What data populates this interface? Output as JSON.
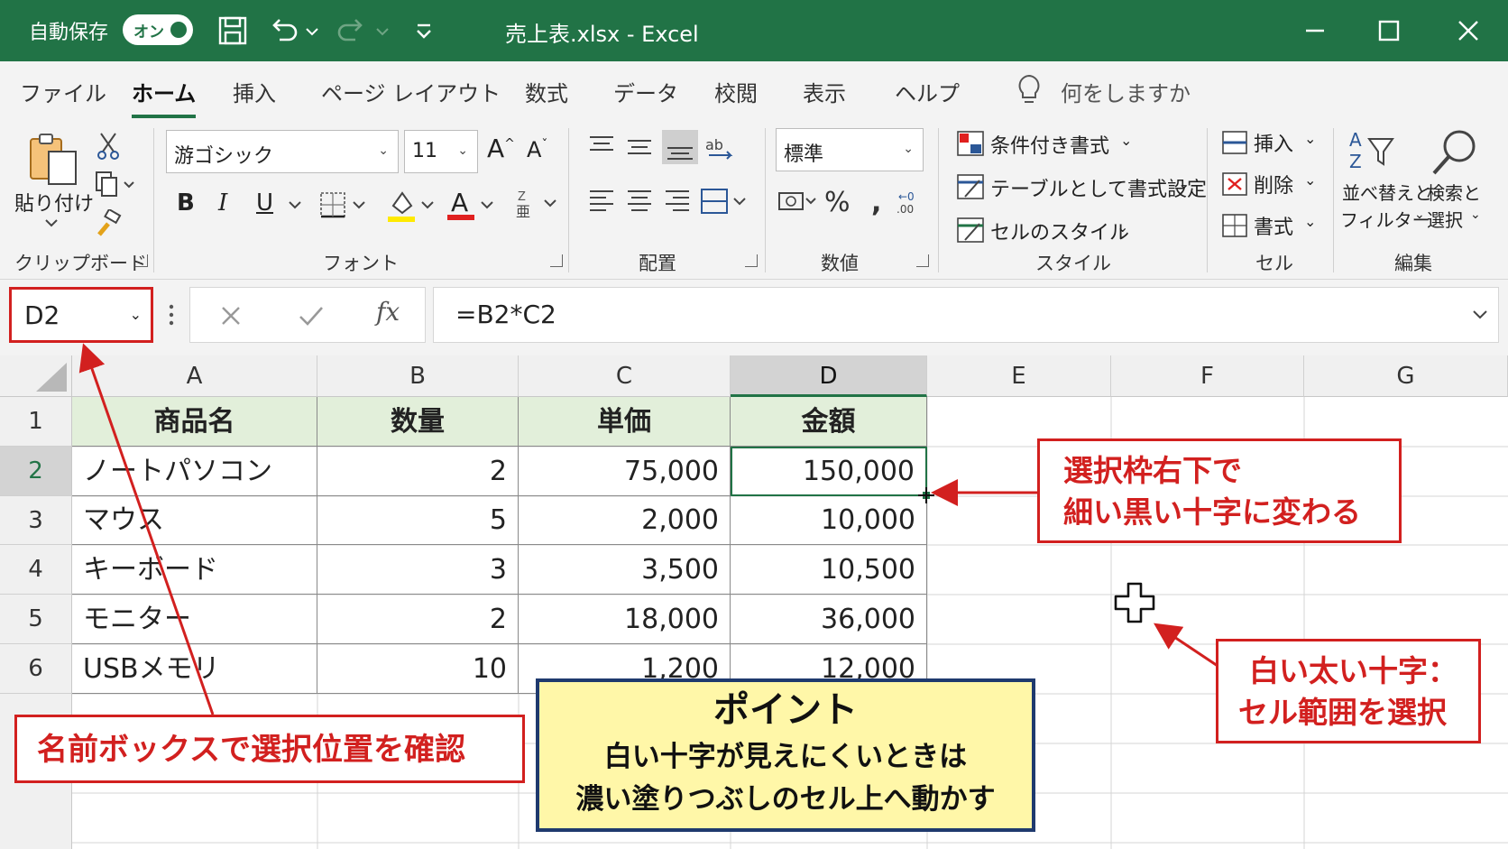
{
  "titlebar": {
    "autosave_label": "自動保存",
    "toggle_label": "オン",
    "doc_title": "売上表.xlsx  -  Excel",
    "bg_color": "#217346"
  },
  "tabs": [
    {
      "label": "ファイル",
      "active": false
    },
    {
      "label": "ホーム",
      "active": true
    },
    {
      "label": "挿入",
      "active": false
    },
    {
      "label": "ページ レイアウト",
      "active": false
    },
    {
      "label": "数式",
      "active": false
    },
    {
      "label": "データ",
      "active": false
    },
    {
      "label": "校閲",
      "active": false
    },
    {
      "label": "表示",
      "active": false
    },
    {
      "label": "ヘルプ",
      "active": false
    }
  ],
  "tell_me": "何をしますか",
  "ribbon": {
    "clipboard": {
      "paste_label": "貼り付け",
      "group_label": "クリップボード"
    },
    "font": {
      "font_name": "游ゴシック",
      "font_size": "11",
      "group_label": "フォント"
    },
    "alignment": {
      "group_label": "配置"
    },
    "number": {
      "format": "標準",
      "group_label": "数値"
    },
    "styles": {
      "conditional": "条件付き書式",
      "table": "テーブルとして書式設定",
      "cell_styles": "セルのスタイル",
      "group_label": "スタイル"
    },
    "cells": {
      "insert": "挿入",
      "delete": "削除",
      "format": "書式",
      "group_label": "セル"
    },
    "editing": {
      "sort_line1": "並べ替えと",
      "sort_line2": "フィルター",
      "find_line1": "検索と",
      "find_line2": "選択",
      "group_label": "編集"
    }
  },
  "formula_bar": {
    "name_box": "D2",
    "formula": "=B2*C2",
    "fx": "fx"
  },
  "grid": {
    "columns": [
      "A",
      "B",
      "C",
      "D",
      "E",
      "F",
      "G"
    ],
    "selected_column": "D",
    "rows": [
      "1",
      "2",
      "3",
      "4",
      "5",
      "6"
    ],
    "selected_row": "2",
    "header": [
      "商品名",
      "数量",
      "単価",
      "金額"
    ],
    "data": [
      [
        "ノートパソコン",
        "2",
        "75,000",
        "150,000"
      ],
      [
        "マウス",
        "5",
        "2,000",
        "10,000"
      ],
      [
        "キーボード",
        "3",
        "3,500",
        "10,500"
      ],
      [
        "モニター",
        "2",
        "18,000",
        "36,000"
      ],
      [
        "USBメモリ",
        "10",
        "1,200",
        "12,000"
      ]
    ],
    "header_fill": "#e2efda"
  },
  "callouts": {
    "fill_handle_line1": "選択枠右下で",
    "fill_handle_line2": "細い黒い十字に変わる",
    "white_cross_line1": "白い太い十字：",
    "white_cross_line2": "セル範囲を選択",
    "name_box_note": "名前ボックスで選択位置を確認",
    "point_title": "ポイント",
    "point_line1": "白い十字が見えにくいときは",
    "point_line2": "濃い塗りつぶしのセル上へ動かす",
    "red_color": "#d2201f",
    "navy_color": "#1f3a6e",
    "yellow_fill": "#fff7a8"
  }
}
